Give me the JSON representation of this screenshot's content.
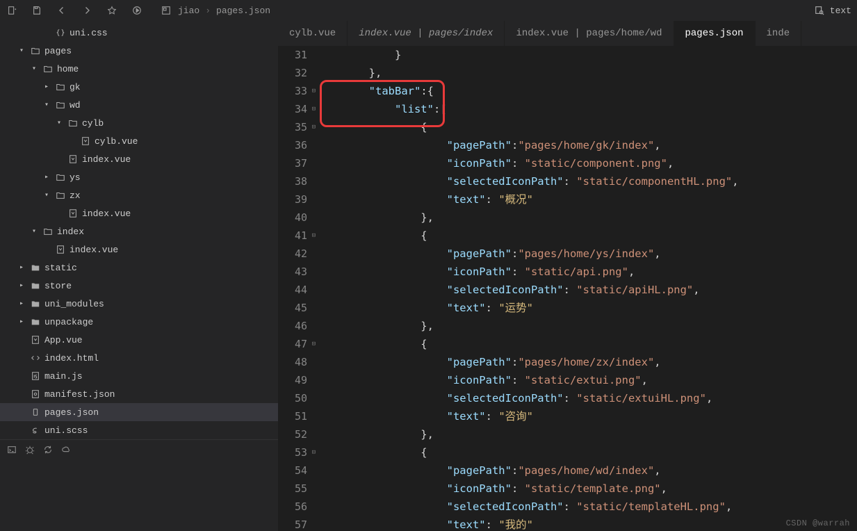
{
  "titlebar": {
    "project": "jiao",
    "file": "pages.json",
    "search": "text"
  },
  "fileTree": [
    {
      "depth": 3,
      "chev": "",
      "icon": "braces",
      "label": "uni.css"
    },
    {
      "depth": 1,
      "chev": "v",
      "icon": "folder",
      "label": "pages"
    },
    {
      "depth": 2,
      "chev": "v",
      "icon": "folder",
      "label": "home"
    },
    {
      "depth": 3,
      "chev": ">",
      "icon": "folder",
      "label": "gk"
    },
    {
      "depth": 3,
      "chev": "v",
      "icon": "folder",
      "label": "wd"
    },
    {
      "depth": 4,
      "chev": "v",
      "icon": "folder",
      "label": "cylb"
    },
    {
      "depth": 5,
      "chev": "",
      "icon": "vue",
      "label": "cylb.vue"
    },
    {
      "depth": 4,
      "chev": "",
      "icon": "vue",
      "label": "index.vue"
    },
    {
      "depth": 3,
      "chev": ">",
      "icon": "folder",
      "label": "ys"
    },
    {
      "depth": 3,
      "chev": "v",
      "icon": "folder",
      "label": "zx"
    },
    {
      "depth": 4,
      "chev": "",
      "icon": "vue",
      "label": "index.vue"
    },
    {
      "depth": 2,
      "chev": "v",
      "icon": "folder",
      "label": "index"
    },
    {
      "depth": 3,
      "chev": "",
      "icon": "vue",
      "label": "index.vue"
    },
    {
      "depth": 1,
      "chev": ">",
      "icon": "folder-solid",
      "label": "static"
    },
    {
      "depth": 1,
      "chev": ">",
      "icon": "folder-solid",
      "label": "store"
    },
    {
      "depth": 1,
      "chev": ">",
      "icon": "folder-solid",
      "label": "uni_modules"
    },
    {
      "depth": 1,
      "chev": ">",
      "icon": "folder-solid",
      "label": "unpackage"
    },
    {
      "depth": 1,
      "chev": "",
      "icon": "vue",
      "label": "App.vue"
    },
    {
      "depth": 1,
      "chev": "",
      "icon": "html",
      "label": "index.html"
    },
    {
      "depth": 1,
      "chev": "",
      "icon": "js",
      "label": "main.js"
    },
    {
      "depth": 1,
      "chev": "",
      "icon": "manifest",
      "label": "manifest.json"
    },
    {
      "depth": 1,
      "chev": "",
      "icon": "json",
      "label": "pages.json",
      "active": true
    },
    {
      "depth": 1,
      "chev": "",
      "icon": "scss",
      "label": "uni.scss"
    }
  ],
  "tabs": [
    {
      "label": "cylb.vue"
    },
    {
      "label": "index.vue | pages/index",
      "italic": true
    },
    {
      "label": "index.vue | pages/home/wd"
    },
    {
      "label": "pages.json",
      "active": true
    },
    {
      "label": "inde"
    }
  ],
  "codeLines": [
    {
      "n": 31,
      "tokens": [
        [
          "p",
          "            }"
        ]
      ]
    },
    {
      "n": 32,
      "tokens": [
        [
          "p",
          "        },"
        ]
      ]
    },
    {
      "n": 33,
      "fold": true,
      "tokens": [
        [
          "p",
          "        "
        ],
        [
          "key",
          "\"tabBar\""
        ],
        [
          "p",
          ":{"
        ]
      ]
    },
    {
      "n": 34,
      "fold": true,
      "tokens": [
        [
          "p",
          "            "
        ],
        [
          "key",
          "\"list\""
        ],
        [
          "p",
          ":["
        ]
      ]
    },
    {
      "n": 35,
      "fold": true,
      "tokens": [
        [
          "p",
          "                {"
        ]
      ]
    },
    {
      "n": 36,
      "tokens": [
        [
          "p",
          "                    "
        ],
        [
          "key",
          "\"pagePath\""
        ],
        [
          "p",
          ":"
        ],
        [
          "str",
          "\"pages/home/gk/index\""
        ],
        [
          "p",
          ","
        ]
      ]
    },
    {
      "n": 37,
      "tokens": [
        [
          "p",
          "                    "
        ],
        [
          "key",
          "\"iconPath\""
        ],
        [
          "p",
          ": "
        ],
        [
          "str",
          "\"static/component.png\""
        ],
        [
          "p",
          ","
        ]
      ]
    },
    {
      "n": 38,
      "tokens": [
        [
          "p",
          "                    "
        ],
        [
          "key",
          "\"selectedIconPath\""
        ],
        [
          "p",
          ": "
        ],
        [
          "str",
          "\"static/componentHL.png\""
        ],
        [
          "p",
          ","
        ]
      ]
    },
    {
      "n": 39,
      "tokens": [
        [
          "p",
          "                    "
        ],
        [
          "key",
          "\"text\""
        ],
        [
          "p",
          ": "
        ],
        [
          "zh",
          "\"概况\""
        ]
      ]
    },
    {
      "n": 40,
      "tokens": [
        [
          "p",
          "                },"
        ]
      ]
    },
    {
      "n": 41,
      "fold": true,
      "tokens": [
        [
          "p",
          "                {"
        ]
      ]
    },
    {
      "n": 42,
      "tokens": [
        [
          "p",
          "                    "
        ],
        [
          "key",
          "\"pagePath\""
        ],
        [
          "p",
          ":"
        ],
        [
          "str",
          "\"pages/home/ys/index\""
        ],
        [
          "p",
          ","
        ]
      ]
    },
    {
      "n": 43,
      "tokens": [
        [
          "p",
          "                    "
        ],
        [
          "key",
          "\"iconPath\""
        ],
        [
          "p",
          ": "
        ],
        [
          "str",
          "\"static/api.png\""
        ],
        [
          "p",
          ","
        ]
      ]
    },
    {
      "n": 44,
      "tokens": [
        [
          "p",
          "                    "
        ],
        [
          "key",
          "\"selectedIconPath\""
        ],
        [
          "p",
          ": "
        ],
        [
          "str",
          "\"static/apiHL.png\""
        ],
        [
          "p",
          ","
        ]
      ]
    },
    {
      "n": 45,
      "tokens": [
        [
          "p",
          "                    "
        ],
        [
          "key",
          "\"text\""
        ],
        [
          "p",
          ": "
        ],
        [
          "zh",
          "\"运势\""
        ]
      ]
    },
    {
      "n": 46,
      "tokens": [
        [
          "p",
          "                },"
        ]
      ]
    },
    {
      "n": 47,
      "fold": true,
      "tokens": [
        [
          "p",
          "                {"
        ]
      ]
    },
    {
      "n": 48,
      "tokens": [
        [
          "p",
          "                    "
        ],
        [
          "key",
          "\"pagePath\""
        ],
        [
          "p",
          ":"
        ],
        [
          "str",
          "\"pages/home/zx/index\""
        ],
        [
          "p",
          ","
        ]
      ]
    },
    {
      "n": 49,
      "tokens": [
        [
          "p",
          "                    "
        ],
        [
          "key",
          "\"iconPath\""
        ],
        [
          "p",
          ": "
        ],
        [
          "str",
          "\"static/extui.png\""
        ],
        [
          "p",
          ","
        ]
      ]
    },
    {
      "n": 50,
      "tokens": [
        [
          "p",
          "                    "
        ],
        [
          "key",
          "\"selectedIconPath\""
        ],
        [
          "p",
          ": "
        ],
        [
          "str",
          "\"static/extuiHL.png\""
        ],
        [
          "p",
          ","
        ]
      ]
    },
    {
      "n": 51,
      "tokens": [
        [
          "p",
          "                    "
        ],
        [
          "key",
          "\"text\""
        ],
        [
          "p",
          ": "
        ],
        [
          "zh",
          "\"咨询\""
        ]
      ]
    },
    {
      "n": 52,
      "tokens": [
        [
          "p",
          "                },"
        ]
      ]
    },
    {
      "n": 53,
      "fold": true,
      "tokens": [
        [
          "p",
          "                {"
        ]
      ]
    },
    {
      "n": 54,
      "tokens": [
        [
          "p",
          "                    "
        ],
        [
          "key",
          "\"pagePath\""
        ],
        [
          "p",
          ":"
        ],
        [
          "str",
          "\"pages/home/wd/index\""
        ],
        [
          "p",
          ","
        ]
      ]
    },
    {
      "n": 55,
      "tokens": [
        [
          "p",
          "                    "
        ],
        [
          "key",
          "\"iconPath\""
        ],
        [
          "p",
          ": "
        ],
        [
          "str",
          "\"static/template.png\""
        ],
        [
          "p",
          ","
        ]
      ]
    },
    {
      "n": 56,
      "tokens": [
        [
          "p",
          "                    "
        ],
        [
          "key",
          "\"selectedIconPath\""
        ],
        [
          "p",
          ": "
        ],
        [
          "str",
          "\"static/templateHL.png\""
        ],
        [
          "p",
          ","
        ]
      ]
    },
    {
      "n": 57,
      "tokens": [
        [
          "p",
          "                    "
        ],
        [
          "key",
          "\"text\""
        ],
        [
          "p",
          ": "
        ],
        [
          "zh",
          "\"我的\""
        ]
      ]
    }
  ],
  "watermark": "CSDN @warrah"
}
